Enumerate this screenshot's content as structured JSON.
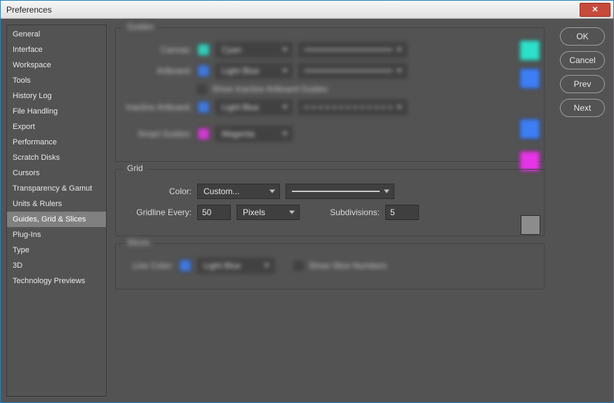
{
  "window": {
    "title": "Preferences"
  },
  "buttons": {
    "ok": "OK",
    "cancel": "Cancel",
    "prev": "Prev",
    "next": "Next",
    "close_x": "✕"
  },
  "sidebar": {
    "items": [
      {
        "label": "General"
      },
      {
        "label": "Interface"
      },
      {
        "label": "Workspace"
      },
      {
        "label": "Tools"
      },
      {
        "label": "History Log"
      },
      {
        "label": "File Handling"
      },
      {
        "label": "Export"
      },
      {
        "label": "Performance"
      },
      {
        "label": "Scratch Disks"
      },
      {
        "label": "Cursors"
      },
      {
        "label": "Transparency & Gamut"
      },
      {
        "label": "Units & Rulers"
      },
      {
        "label": "Guides, Grid & Slices"
      },
      {
        "label": "Plug-Ins"
      },
      {
        "label": "Type"
      },
      {
        "label": "3D"
      },
      {
        "label": "Technology Previews"
      }
    ],
    "active_index": 12
  },
  "guides": {
    "title": "Guides",
    "canvas_label": "Canvas:",
    "canvas_color_name": "Cyan",
    "canvas_swatch": "#2de0c9",
    "artboard_label": "Artboard:",
    "artboard_color_name": "Light Blue",
    "artboard_swatch": "#3d7ef5",
    "show_inactive_label": "Show Inactive Artboard Guides",
    "inactive_label": "Inactive Artboard:",
    "inactive_color_name": "Light Blue",
    "inactive_swatch": "#3d7ef5",
    "smart_label": "Smart Guides:",
    "smart_color_name": "Magenta",
    "smart_swatch": "#e635e6"
  },
  "grid": {
    "title": "Grid",
    "color_label": "Color:",
    "color_value": "Custom...",
    "gridline_label": "Gridline Every:",
    "gridline_value": "50",
    "gridline_unit": "Pixels",
    "subdiv_label": "Subdivisions:",
    "subdiv_value": "5",
    "swatch": "#8c8c8c"
  },
  "slices": {
    "title": "Slices",
    "line_color_label": "Line Color:",
    "line_color_name": "Light Blue",
    "line_swatch": "#3d7ef5",
    "show_numbers_label": "Show Slice Numbers"
  }
}
